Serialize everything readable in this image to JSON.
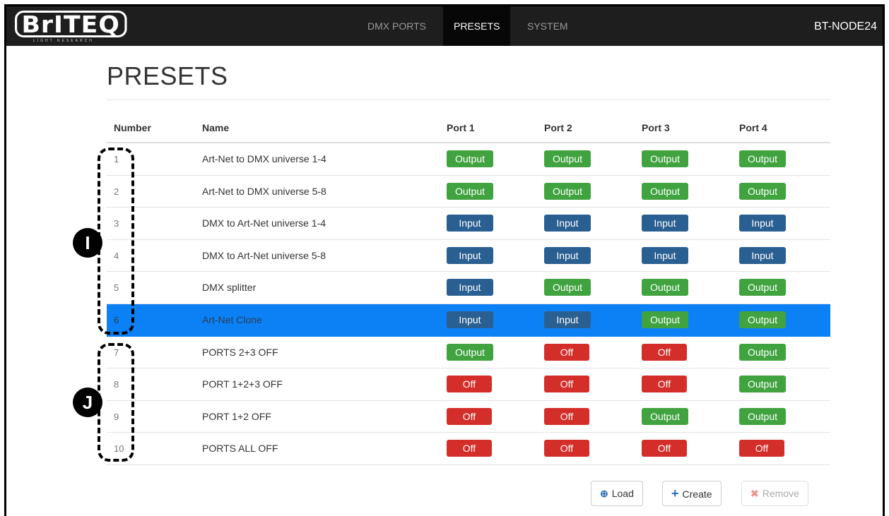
{
  "header": {
    "brand": "BrITEQ",
    "brand_tagline": "LIGHT RESEARCH",
    "tabs": [
      {
        "label": "DMX PORTS",
        "active": false
      },
      {
        "label": "PRESETS",
        "active": true
      },
      {
        "label": "SYSTEM",
        "active": false
      }
    ],
    "device_name": "BT-NODE24"
  },
  "page": {
    "title": "PRESETS"
  },
  "table": {
    "columns": [
      "Number",
      "Name",
      "Port 1",
      "Port 2",
      "Port 3",
      "Port 4"
    ],
    "rows": [
      {
        "number": "1",
        "name": "Art-Net to DMX universe 1-4",
        "ports": [
          "Output",
          "Output",
          "Output",
          "Output"
        ]
      },
      {
        "number": "2",
        "name": "Art-Net to DMX universe 5-8",
        "ports": [
          "Output",
          "Output",
          "Output",
          "Output"
        ]
      },
      {
        "number": "3",
        "name": "DMX to Art-Net universe 1-4",
        "ports": [
          "Input",
          "Input",
          "Input",
          "Input"
        ]
      },
      {
        "number": "4",
        "name": "DMX to Art-Net universe 5-8",
        "ports": [
          "Input",
          "Input",
          "Input",
          "Input"
        ]
      },
      {
        "number": "5",
        "name": "DMX splitter",
        "ports": [
          "Input",
          "Output",
          "Output",
          "Output"
        ]
      },
      {
        "number": "6",
        "name": "Art-Net Clone",
        "ports": [
          "Input",
          "Input",
          "Output",
          "Output"
        ],
        "selected": true
      },
      {
        "number": "7",
        "name": "PORTS 2+3 OFF",
        "ports": [
          "Output",
          "Off",
          "Off",
          "Output"
        ]
      },
      {
        "number": "8",
        "name": "PORT 1+2+3 OFF",
        "ports": [
          "Off",
          "Off",
          "Off",
          "Output"
        ]
      },
      {
        "number": "9",
        "name": "PORT 1+2 OFF",
        "ports": [
          "Off",
          "Off",
          "Output",
          "Output"
        ]
      },
      {
        "number": "10",
        "name": "PORTS ALL OFF",
        "ports": [
          "Off",
          "Off",
          "Off",
          "Off"
        ]
      }
    ]
  },
  "annotations": {
    "marker_i": "I",
    "marker_j": "J"
  },
  "actions": {
    "load_label": "Load",
    "create_label": "Create",
    "remove_label": "Remove"
  },
  "colors": {
    "output": "#41a33f",
    "input": "#2a5f91",
    "off": "#d42e2a",
    "selected_row": "#0c80f5",
    "navbar": "#1e1e1e"
  }
}
